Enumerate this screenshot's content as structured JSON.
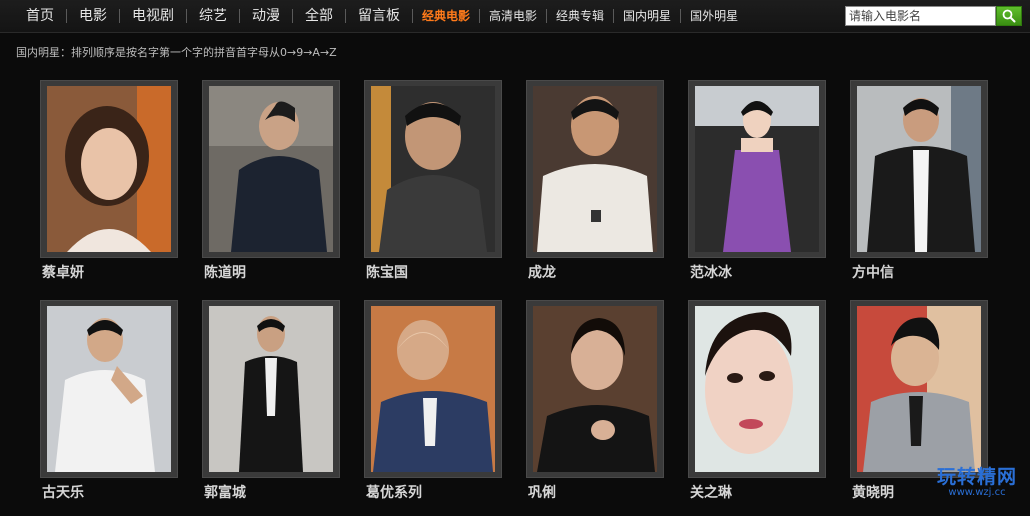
{
  "nav": {
    "items": [
      {
        "label": "首页"
      },
      {
        "label": "电影"
      },
      {
        "label": "电视剧"
      },
      {
        "label": "综艺"
      },
      {
        "label": "动漫"
      },
      {
        "label": "全部"
      },
      {
        "label": "留言板"
      },
      {
        "label": "经典电影",
        "active": true
      },
      {
        "label": "高清电影"
      },
      {
        "label": "经典专辑"
      },
      {
        "label": "国内明星"
      },
      {
        "label": "国外明星"
      }
    ]
  },
  "search": {
    "placeholder": "请输入电影名",
    "button_icon": "search-icon"
  },
  "hint": "国内明星：排列顺序是按名字第一个字的拼音首字母从0→9→A→Z",
  "stars": [
    {
      "name": "蔡卓妍"
    },
    {
      "name": "陈道明"
    },
    {
      "name": "陈宝国"
    },
    {
      "name": "成龙"
    },
    {
      "name": "范冰冰"
    },
    {
      "name": "方中信"
    },
    {
      "name": "古天乐"
    },
    {
      "name": "郭富城"
    },
    {
      "name": "葛优系列"
    },
    {
      "name": "巩俐"
    },
    {
      "name": "关之琳"
    },
    {
      "name": "黄晓明"
    }
  ],
  "watermark": {
    "title": "玩转精网",
    "url": "www.wzj.cc"
  },
  "colors": {
    "accent": "#ff7a1a",
    "search_button": "#4aa51c",
    "watermark": "#2a6fd6"
  }
}
